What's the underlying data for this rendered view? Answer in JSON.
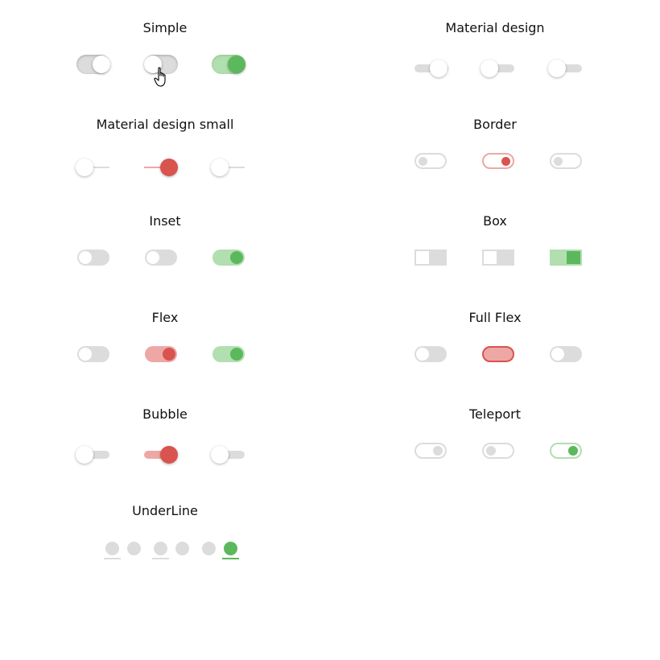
{
  "colors": {
    "off_track": "#dcdcdc",
    "on_green": "#5cb85c",
    "on_green_light": "#b2dfb0",
    "on_red": "#d9534f",
    "on_red_light": "#eda8a6",
    "knob": "#ffffff"
  },
  "groups": [
    {
      "title": "Simple",
      "states": [
        "on-off-knob-right",
        "off",
        "on-green"
      ]
    },
    {
      "title": "Material design",
      "states": [
        "off",
        "off",
        "off"
      ]
    },
    {
      "title": "Material design small",
      "states": [
        "off",
        "on-red",
        "off"
      ]
    },
    {
      "title": "Border",
      "states": [
        "off",
        "on-red",
        "off"
      ]
    },
    {
      "title": "Inset",
      "states": [
        "off",
        "off",
        "on-green"
      ]
    },
    {
      "title": "Box",
      "states": [
        "off",
        "off",
        "on-green"
      ]
    },
    {
      "title": "Flex",
      "states": [
        "off",
        "on-red",
        "on-green"
      ]
    },
    {
      "title": "Full Flex",
      "states": [
        "off",
        "on-red",
        "off"
      ]
    },
    {
      "title": "Bubble",
      "states": [
        "off",
        "on-red",
        "off"
      ]
    },
    {
      "title": "Teleport",
      "states": [
        "off",
        "off",
        "on-green"
      ]
    },
    {
      "title": "UnderLine",
      "states": [
        "off",
        "off",
        "on-green"
      ]
    }
  ],
  "cursor": {
    "icon": "hand-pointer-icon"
  }
}
